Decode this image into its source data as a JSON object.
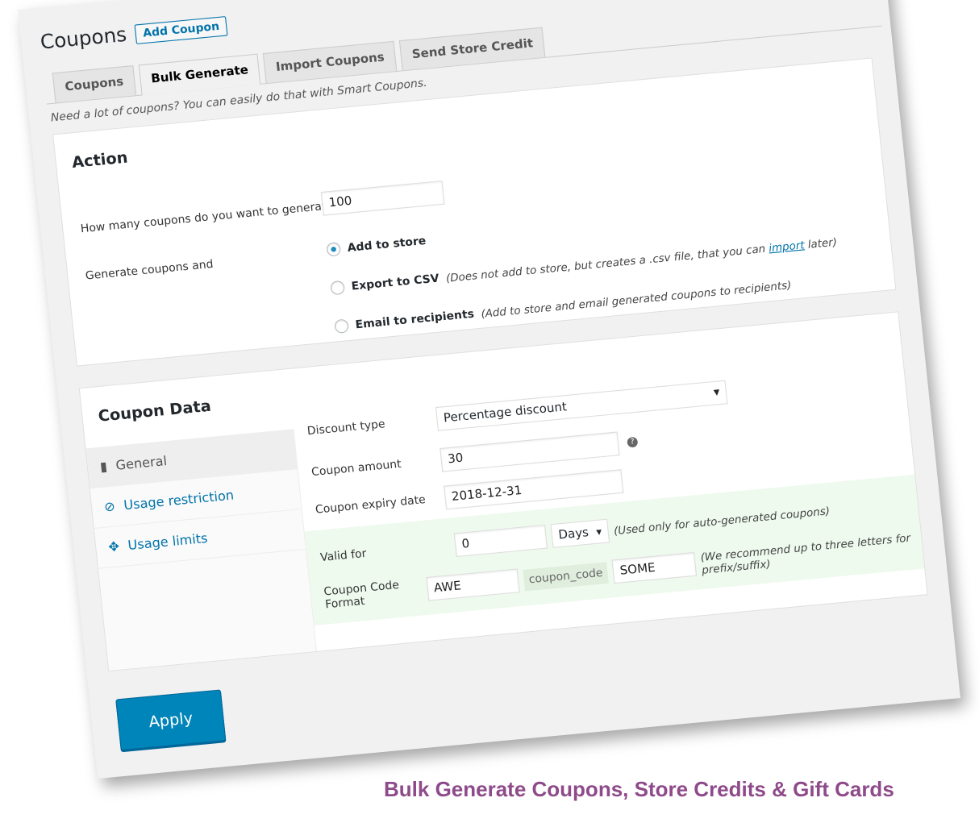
{
  "header": {
    "title": "Coupons",
    "add_button": "Add Coupon"
  },
  "tabs": [
    {
      "label": "Coupons"
    },
    {
      "label": "Bulk Generate",
      "active": true
    },
    {
      "label": "Import Coupons"
    },
    {
      "label": "Send Store Credit"
    }
  ],
  "description": "Need a lot of coupons? You can easily do that with Smart Coupons.",
  "action": {
    "title": "Action",
    "count_label": "How many coupons do you want to generate?",
    "required_mark": "*",
    "count_value": "100",
    "generate_label": "Generate coupons and",
    "options": [
      {
        "label": "Add to store",
        "note": "",
        "selected": true
      },
      {
        "label": "Export to CSV",
        "note_before": "(Does not add to store, but creates a .csv file, that you can ",
        "link": "import",
        "note_after": " later)",
        "selected": false
      },
      {
        "label": "Email to recipients",
        "note": "(Add to store and email generated coupons to recipients)",
        "selected": false
      }
    ]
  },
  "coupon_data": {
    "title": "Coupon Data",
    "sidebar": [
      {
        "label": "General",
        "icon": "ticket-icon",
        "active": true
      },
      {
        "label": "Usage restriction",
        "icon": "block-icon"
      },
      {
        "label": "Usage limits",
        "icon": "arrows-icon"
      }
    ],
    "discount_type": {
      "label": "Discount type",
      "value": "Percentage discount"
    },
    "coupon_amount": {
      "label": "Coupon amount",
      "value": "30"
    },
    "expiry": {
      "label": "Coupon expiry date",
      "value": "2018-12-31"
    },
    "valid_for": {
      "label": "Valid for",
      "value": "0",
      "unit": "Days",
      "note": "(Used only for auto-generated coupons)"
    },
    "code_format": {
      "label": "Coupon Code Format",
      "prefix": "AWE",
      "middle": "coupon_code",
      "suffix": "SOME",
      "note": "(We recommend up to three letters for prefix/suffix)"
    }
  },
  "apply_button": "Apply",
  "caption": "Bulk Generate Coupons, Store Credits & Gift Cards",
  "colors": {
    "accent": "#0073aa",
    "button": "#0085ba",
    "caption": "#8e4a8a",
    "highlight": "#eefaee"
  }
}
